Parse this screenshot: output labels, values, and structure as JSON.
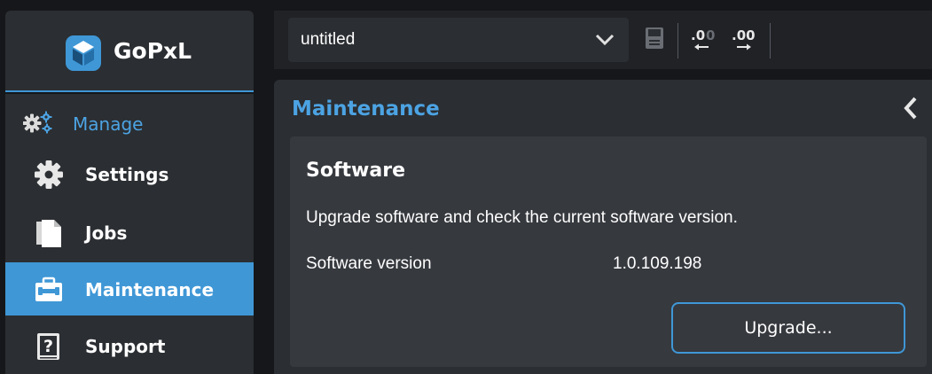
{
  "app": {
    "logo_text": "GoPxL"
  },
  "sidebar": {
    "section_label": "Manage",
    "items": [
      {
        "label": "Settings",
        "icon": "gear-icon"
      },
      {
        "label": "Jobs",
        "icon": "document-icon"
      },
      {
        "label": "Maintenance",
        "icon": "toolbox-icon",
        "active": true
      },
      {
        "label": "Support",
        "icon": "help-book-icon"
      }
    ]
  },
  "toolbar": {
    "job_name": "untitled",
    "icons": [
      "chevron-down-icon",
      "save-icon",
      "decimal-decrease-icon",
      "decimal-increase-icon"
    ]
  },
  "main": {
    "title": "Maintenance",
    "software": {
      "title": "Software",
      "description": "Upgrade software and check the current software version.",
      "version_label": "Software version",
      "version_value": "1.0.109.198",
      "upgrade_label": "Upgrade..."
    }
  },
  "colors": {
    "accent": "#3f97d6",
    "accent_text": "#4ca3e3",
    "panel": "#2b2e32",
    "card": "#36393e",
    "background": "#15171a"
  }
}
